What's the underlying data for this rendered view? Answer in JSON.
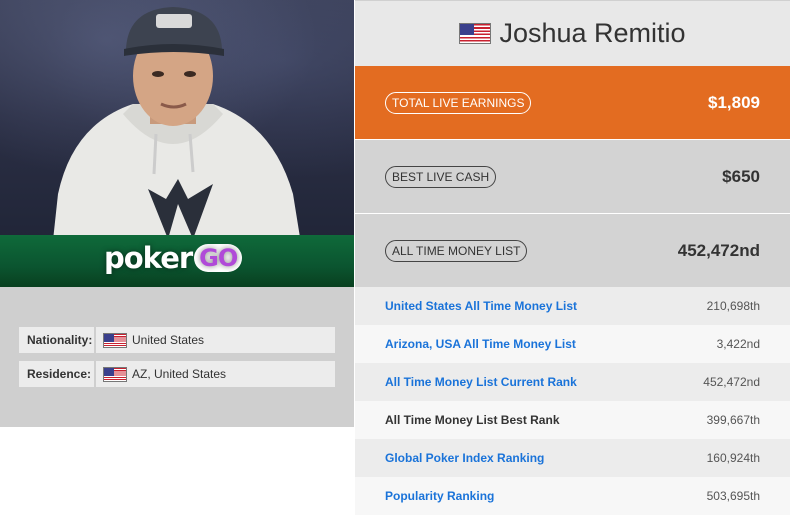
{
  "photo": {
    "logo_main": "poker",
    "logo_accent": "GO"
  },
  "info": {
    "nationality": {
      "label": "Nationality:",
      "value": "United States"
    },
    "residence": {
      "label": "Residence:",
      "value": "AZ, United States"
    }
  },
  "player": {
    "name": "Joshua Remitio",
    "flag": "us-flag-icon"
  },
  "stats": {
    "total_live": {
      "label": "TOTAL LIVE EARNINGS",
      "value": "$1,809"
    },
    "best_cash": {
      "label": "BEST LIVE CASH",
      "value": "$650"
    },
    "money_list": {
      "label": "ALL TIME MONEY LIST",
      "value": "452,472nd"
    }
  },
  "rankings": [
    {
      "label": "United States All Time Money List",
      "value": "210,698th"
    },
    {
      "label": "Arizona, USA All Time Money List",
      "value": "3,422nd"
    },
    {
      "label": "All Time Money List Current Rank",
      "value": "452,472nd"
    },
    {
      "label": "All Time Money List Best Rank",
      "value": "399,667th"
    },
    {
      "label": "Global Poker Index Ranking",
      "value": "160,924th"
    },
    {
      "label": "Popularity Ranking",
      "value": "503,695th"
    }
  ],
  "colors": {
    "accent": "#e36c21",
    "link": "#1a73d9"
  }
}
